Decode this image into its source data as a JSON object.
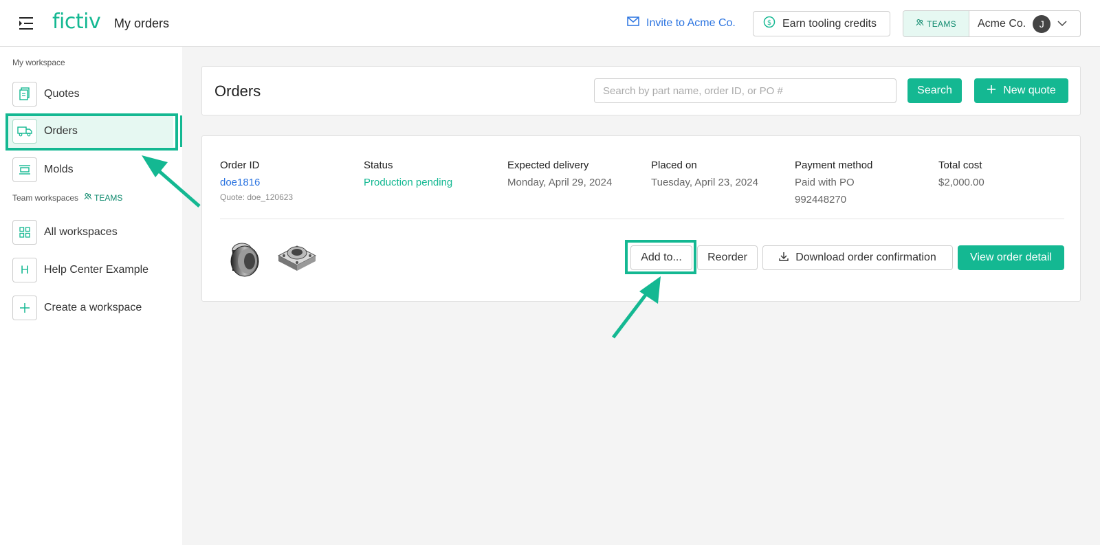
{
  "header": {
    "logo": "fictiv",
    "page_name": "My orders",
    "invite_label": "Invite to Acme Co.",
    "earn_label": "Earn tooling credits",
    "teams_label": "TEAMS",
    "account_name": "Acme Co.",
    "avatar_initial": "J"
  },
  "sidebar": {
    "my_workspace_label": "My workspace",
    "team_workspaces_label": "Team workspaces",
    "teams_tag": "TEAMS",
    "items": [
      {
        "label": "Quotes",
        "icon": "quotes-icon",
        "active": false
      },
      {
        "label": "Orders",
        "icon": "truck-icon",
        "active": true
      },
      {
        "label": "Molds",
        "icon": "molds-icon",
        "active": false
      }
    ],
    "team_items": [
      {
        "label": "All workspaces",
        "icon": "grid-icon"
      },
      {
        "label": "Help Center Example",
        "icon": "letter-h-icon",
        "letter": "H"
      },
      {
        "label": "Create a workspace",
        "icon": "plus-icon"
      }
    ]
  },
  "orders_panel": {
    "title": "Orders",
    "search_placeholder": "Search by part name, order ID, or PO #",
    "search_button": "Search",
    "new_quote_button": "New quote"
  },
  "order": {
    "order_id_head": "Order ID",
    "order_id": "doe1816",
    "quote_ref": "Quote: doe_120623",
    "status_head": "Status",
    "status": "Production pending",
    "delivery_head": "Expected delivery",
    "delivery": "Monday, April 29, 2024",
    "placed_head": "Placed on",
    "placed": "Tuesday, April 23, 2024",
    "payment_head": "Payment method",
    "payment_line1": "Paid with PO",
    "payment_line2": "992448270",
    "total_head": "Total cost",
    "total": "$2,000.00",
    "add_to_button": "Add to...",
    "reorder_button": "Reorder",
    "download_button": "Download order confirmation",
    "view_detail_button": "View order detail"
  },
  "colors": {
    "accent": "#14b892",
    "link": "#2a73e0",
    "active_bg": "#e6f8f2"
  }
}
